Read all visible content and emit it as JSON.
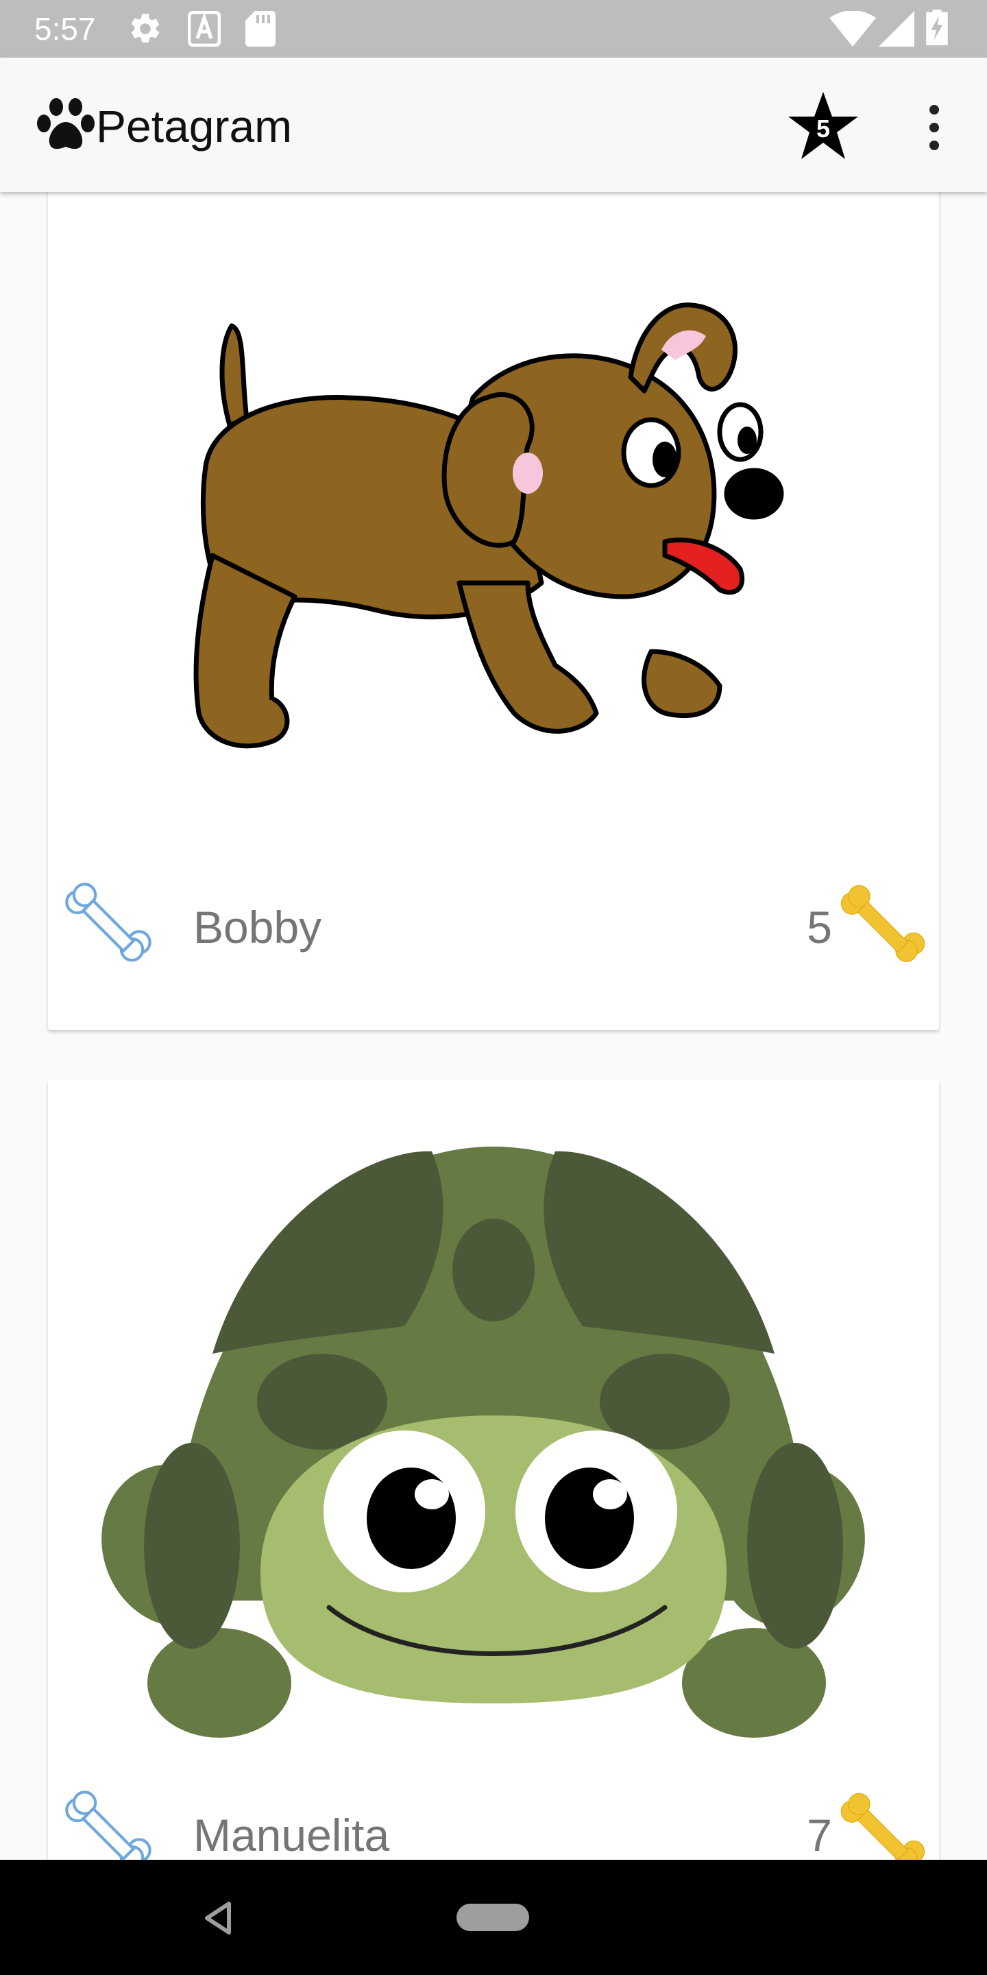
{
  "status_bar": {
    "time": "5:57",
    "icons": [
      "settings-gear-icon",
      "keyboard-a-icon",
      "sd-card-icon",
      "wifi-icon",
      "cell-signal-icon",
      "battery-charging-icon"
    ]
  },
  "app_bar": {
    "logo_icon": "paw-icon",
    "title": "Petagram",
    "favorites_icon": "star-icon",
    "favorites_count": "5",
    "menu_icon": "more-vert-icon"
  },
  "pets": [
    {
      "name": "Bobby",
      "likes": "5",
      "image": "cartoon-puppy",
      "like_button_icon": "bone-outline-icon",
      "rating_icon": "bone-filled-icon"
    },
    {
      "name": "Manuelita",
      "likes": "7",
      "image": "cartoon-turtle",
      "like_button_icon": "bone-outline-icon",
      "rating_icon": "bone-filled-icon"
    }
  ],
  "nav_bar": {
    "back_icon": "back-triangle-icon",
    "home_icon": "home-pill-icon"
  },
  "colors": {
    "status_bar": "#bdbdbd",
    "app_bar": "#f8f8f8",
    "background": "#fafafa",
    "bone_outline": "#6fa8dc",
    "bone_filled": "#f1c232",
    "text_secondary": "#757575"
  }
}
